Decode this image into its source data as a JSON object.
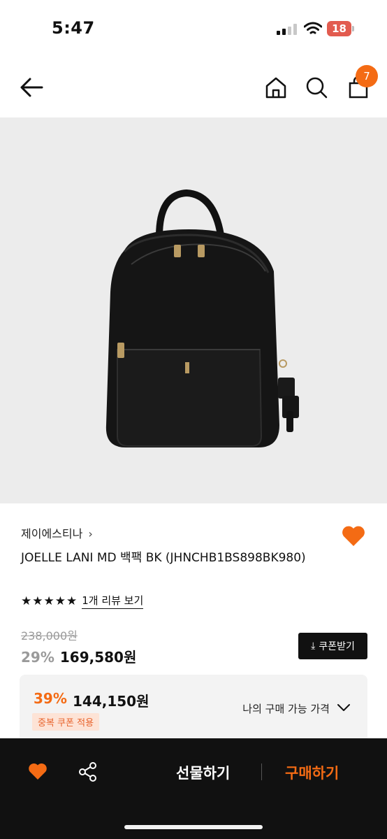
{
  "status_bar": {
    "time": "5:47",
    "battery": "18",
    "icons": [
      "signal-icon",
      "wifi-icon",
      "battery-icon"
    ]
  },
  "nav": {
    "icons": [
      "back-arrow-icon",
      "home-icon",
      "search-icon",
      "shopping-bag-icon"
    ],
    "cart_count": "7"
  },
  "product": {
    "brand": "제이에스티나",
    "brand_chevron": "›",
    "name": "JOELLE LANI MD 백팩 BK (JHNCHB1BS898BK980)",
    "stars": "★★★★★",
    "review_link": "1개 리뷰 보기",
    "original_price": "238,000원",
    "discount_pct": "29%",
    "sale_price": "169,580원",
    "coupon_button": "쿠폰받기",
    "my_price_pct": "39%",
    "my_price": "144,150원",
    "dup_coupon_badge": "중복 쿠폰 적용",
    "my_price_label": "나의 구매 가능 가격"
  },
  "bottom_bar": {
    "gift_label": "선물하기",
    "buy_label": "구매하기",
    "icons": [
      "heart-icon",
      "share-icon"
    ]
  },
  "colors": {
    "accent": "#f46b14",
    "heart": "#f46b14",
    "image_bg": "#ececec",
    "bottom_bar_bg": "#111111"
  }
}
